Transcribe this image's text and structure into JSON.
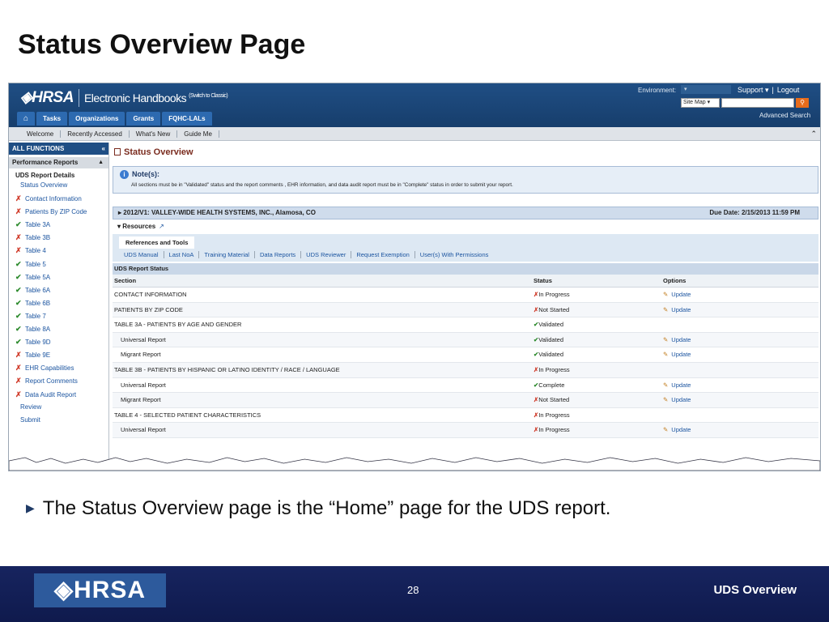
{
  "slide": {
    "title": "Status Overview Page",
    "bullet": "The Status Overview page is the “Home” page for the UDS report.",
    "page_number": "28",
    "footer_title": "UDS Overview",
    "footer_logo": "◈HRSA"
  },
  "header": {
    "logo": "◈HRSA",
    "app_title": "Electronic Handbooks",
    "switch_classic": "(Switch to Classic)",
    "environment_label": "Environment:",
    "support": "Support ▾",
    "logout": "Logout",
    "site_map": "Site Map",
    "advanced_search": "Advanced Search",
    "tabs": [
      "Tasks",
      "Organizations",
      "Grants",
      "FQHC-LALs"
    ],
    "home_icon": "home-icon"
  },
  "subnav": {
    "items": [
      "Welcome",
      "Recently Accessed",
      "What's New",
      "Guide Me"
    ]
  },
  "sidebar": {
    "all_functions": "ALL FUNCTIONS",
    "performance_reports": "Performance Reports",
    "uds_report_details": "UDS Report Details",
    "items": [
      {
        "label": "Status Overview",
        "mark": ""
      },
      {
        "label": "Contact Information",
        "mark": "✗"
      },
      {
        "label": "Patients By ZIP Code",
        "mark": "✗"
      },
      {
        "label": "Table 3A",
        "mark": "✔"
      },
      {
        "label": "Table 3B",
        "mark": "✗"
      },
      {
        "label": "Table 4",
        "mark": "✗"
      },
      {
        "label": "Table 5",
        "mark": "✔"
      },
      {
        "label": "Table 5A",
        "mark": "✔"
      },
      {
        "label": "Table 6A",
        "mark": "✔"
      },
      {
        "label": "Table 6B",
        "mark": "✔"
      },
      {
        "label": "Table 7",
        "mark": "✔"
      },
      {
        "label": "Table 8A",
        "mark": "✔"
      },
      {
        "label": "Table 9D",
        "mark": "✔"
      },
      {
        "label": "Table 9E",
        "mark": "✗"
      },
      {
        "label": "EHR Capabilities",
        "mark": "✗"
      },
      {
        "label": "Report Comments",
        "mark": "✗"
      },
      {
        "label": "Data Audit Report",
        "mark": "✗"
      },
      {
        "label": "Review",
        "mark": ""
      },
      {
        "label": "Submit",
        "mark": ""
      }
    ]
  },
  "main": {
    "page_title": "Status Overview",
    "notes_title": "Note(s):",
    "notes_text": "All sections must be in \"Validated\" status and the report comments , EHR information, and data audit report must be in \"Complete\" status in order to submit your report.",
    "grant_label": "2012/V1: VALLEY-WIDE HEALTH SYSTEMS, INC., Alamosa, CO",
    "due_date": "Due Date: 2/15/2013 11:59 PM",
    "resources": "Resources",
    "references_tab": "References and Tools",
    "reference_links": [
      "UDS Manual",
      "Last NoA",
      "Training Material",
      "Data Reports",
      "UDS Reviewer",
      "Request Exemption",
      "User(s) With Permissions"
    ],
    "status_header": "UDS Report Status",
    "columns": {
      "section": "Section",
      "status": "Status",
      "options": "Options"
    },
    "rows": [
      {
        "section": "CONTACT INFORMATION",
        "status": "In Progress",
        "mark": "✗",
        "option": "Update",
        "indent": false
      },
      {
        "section": "PATIENTS BY ZIP CODE",
        "status": "Not Started",
        "mark": "✗",
        "option": "Update",
        "indent": false
      },
      {
        "section": "TABLE 3A - PATIENTS BY AGE AND GENDER",
        "status": "Validated",
        "mark": "✔",
        "option": "",
        "indent": false
      },
      {
        "section": "Universal Report",
        "status": "Validated",
        "mark": "✔",
        "option": "Update",
        "indent": true
      },
      {
        "section": "Migrant Report",
        "status": "Validated",
        "mark": "✔",
        "option": "Update",
        "indent": true
      },
      {
        "section": "TABLE 3B - PATIENTS BY HISPANIC OR LATINO IDENTITY / RACE / LANGUAGE",
        "status": "In Progress",
        "mark": "✗",
        "option": "",
        "indent": false
      },
      {
        "section": "Universal Report",
        "status": "Complete",
        "mark": "✔",
        "option": "Update",
        "indent": true
      },
      {
        "section": "Migrant Report",
        "status": "Not Started",
        "mark": "✗",
        "option": "Update",
        "indent": true
      },
      {
        "section": "TABLE 4 - SELECTED PATIENT CHARACTERISTICS",
        "status": "In Progress",
        "mark": "✗",
        "option": "",
        "indent": false
      },
      {
        "section": "Universal Report",
        "status": "In Progress",
        "mark": "✗",
        "option": "Update",
        "indent": true
      }
    ]
  },
  "colors": {
    "header_blue": "#1f4e84",
    "footer_navy": "#17245f",
    "validated_green": "#2e8b2e",
    "error_red": "#d03b2a",
    "link_blue": "#1c55a0"
  }
}
